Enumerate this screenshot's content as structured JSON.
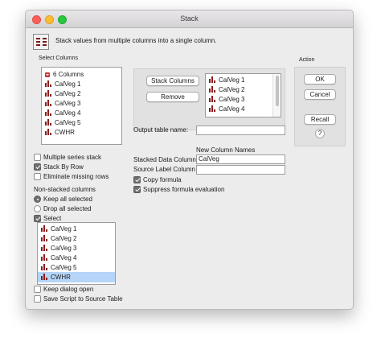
{
  "window": {
    "title": "Stack"
  },
  "description": "Stack values from multiple columns into a single column.",
  "select_columns": {
    "label": "Select Columns",
    "header": "6 Columns",
    "items": [
      "CalVeg 1",
      "CalVeg 2",
      "CalVeg 3",
      "CalVeg 4",
      "CalVeg 5",
      "CWHR"
    ]
  },
  "stack_columns": {
    "button": "Stack Columns",
    "remove_button": "Remove",
    "items": [
      "CalVeg 1",
      "CalVeg 2",
      "CalVeg 3",
      "CalVeg 4"
    ]
  },
  "output_table": {
    "label": "Output table name:",
    "value": ""
  },
  "new_column_names": {
    "header": "New Column Names",
    "stacked_label": "Stacked Data Column",
    "stacked_value": "CalVeg",
    "source_label": "Source Label Column",
    "source_value": ""
  },
  "options": {
    "copy_formula": "Copy formula",
    "suppress_formula": "Suppress formula evaluation",
    "multiple_series": "Multiple series stack",
    "stack_by_row": "Stack By Row",
    "eliminate_missing": "Eliminate missing rows"
  },
  "non_stacked": {
    "label": "Non-stacked columns",
    "keep_all": "Keep all selected",
    "drop_all": "Drop all selected",
    "select": "Select",
    "items": [
      "CalVeg 1",
      "CalVeg 2",
      "CalVeg 3",
      "CalVeg 4",
      "CalVeg 5",
      "CWHR"
    ]
  },
  "action": {
    "label": "Action",
    "ok": "OK",
    "cancel": "Cancel",
    "recall": "Recall",
    "help": "?"
  },
  "footer": {
    "keep_open": "Keep dialog open",
    "save_script": "Save Script to Source Table"
  },
  "icons": {
    "column": "bar-chart-column-icon",
    "app": "stack-platform-icon",
    "disclosure": "disclosure-triangle-icon"
  },
  "colors": {
    "selection": "#b5d4f7",
    "column_icon": "#8a1d1d",
    "disclosure": "#c23a3a"
  }
}
